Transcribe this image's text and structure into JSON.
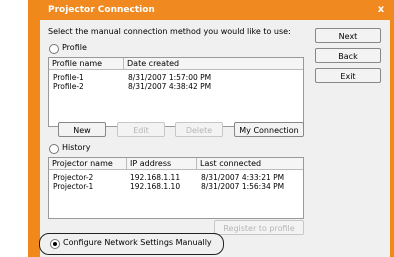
{
  "window": {
    "title": "Projector Connection",
    "close_glyph": "x"
  },
  "instruction": "Select the manual connection method you would like to use:",
  "profile": {
    "radio_label": "Profile",
    "columns": [
      "Profile name",
      "Date created"
    ],
    "rows": [
      [
        "Profile-1",
        "8/31/2007 1:57:00 PM"
      ],
      [
        "Profile-2",
        "8/31/2007 4:38:42 PM"
      ]
    ],
    "buttons": {
      "new": "New",
      "edit": "Edit",
      "delete": "Delete",
      "my_connection": "My Connection"
    }
  },
  "history": {
    "radio_label": "History",
    "columns": [
      "Projector name",
      "IP address",
      "Last connected"
    ],
    "rows": [
      [
        "Projector-2",
        "192.168.1.11",
        "8/31/2007 4:33:21 PM"
      ],
      [
        "Projector-1",
        "192.168.1.10",
        "8/31/2007 1:56:34 PM"
      ]
    ],
    "register_button": "Register to profile"
  },
  "configure_manually": "Configure Network Settings Manually",
  "side_buttons": {
    "next": "Next",
    "back": "Back",
    "exit": "Exit"
  },
  "colors": {
    "frame": "#f0881a",
    "dialog_bg": "#f0f0f0"
  }
}
